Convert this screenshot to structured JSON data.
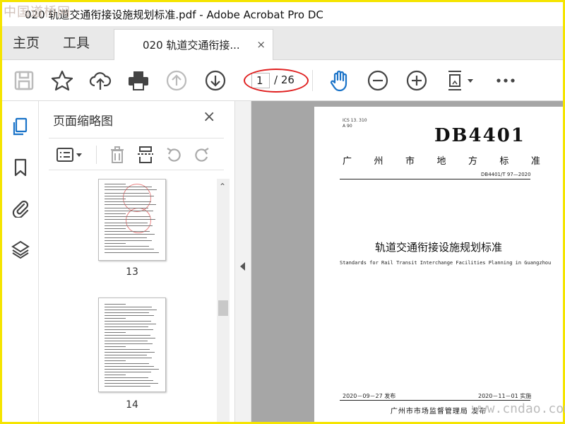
{
  "window": {
    "title": "020 轨道交通衔接设施规划标准.pdf - Adobe Acrobat Pro DC"
  },
  "watermarks": {
    "top_left": "中国道桥网",
    "bottom_right": "www.cndao.com"
  },
  "tabs": {
    "home": "主页",
    "tools": "工具",
    "document": "020 轨道交通衔接...",
    "close_glyph": "×"
  },
  "toolbar": {
    "current_page": "1",
    "total_pages": "/ 26",
    "icons": [
      "save-icon",
      "bookmark-star-icon",
      "cloud-upload-icon",
      "print-icon",
      "page-up-icon",
      "page-down-icon",
      "hand-tool-icon",
      "zoom-out-icon",
      "zoom-in-icon",
      "fit-page-icon",
      "more-icon"
    ],
    "accent": "#1a73c8",
    "highlight_circle": "#e02020"
  },
  "thumbnail_panel": {
    "title": "页面缩略图",
    "close_glyph": "×",
    "thumbnails": [
      {
        "label": "13"
      },
      {
        "label": "14"
      }
    ]
  },
  "document_page": {
    "ics": "ICS 13. 310",
    "ccs": "A 90",
    "standard_code": "DB4401",
    "standard_type": [
      "广",
      "州",
      "市",
      "地",
      "方",
      "标",
      "准"
    ],
    "number": "DB4401/T 97—2020",
    "title_cn": "轨道交通衔接设施规划标准",
    "title_en": "Standards for Rail Transit Interchange Facilities Planning in Guangzhou",
    "issue_date": "2020－09－27 发布",
    "implement_date": "2020－11－01 实施",
    "issuer": "广州市市场监督管理局  发布"
  }
}
